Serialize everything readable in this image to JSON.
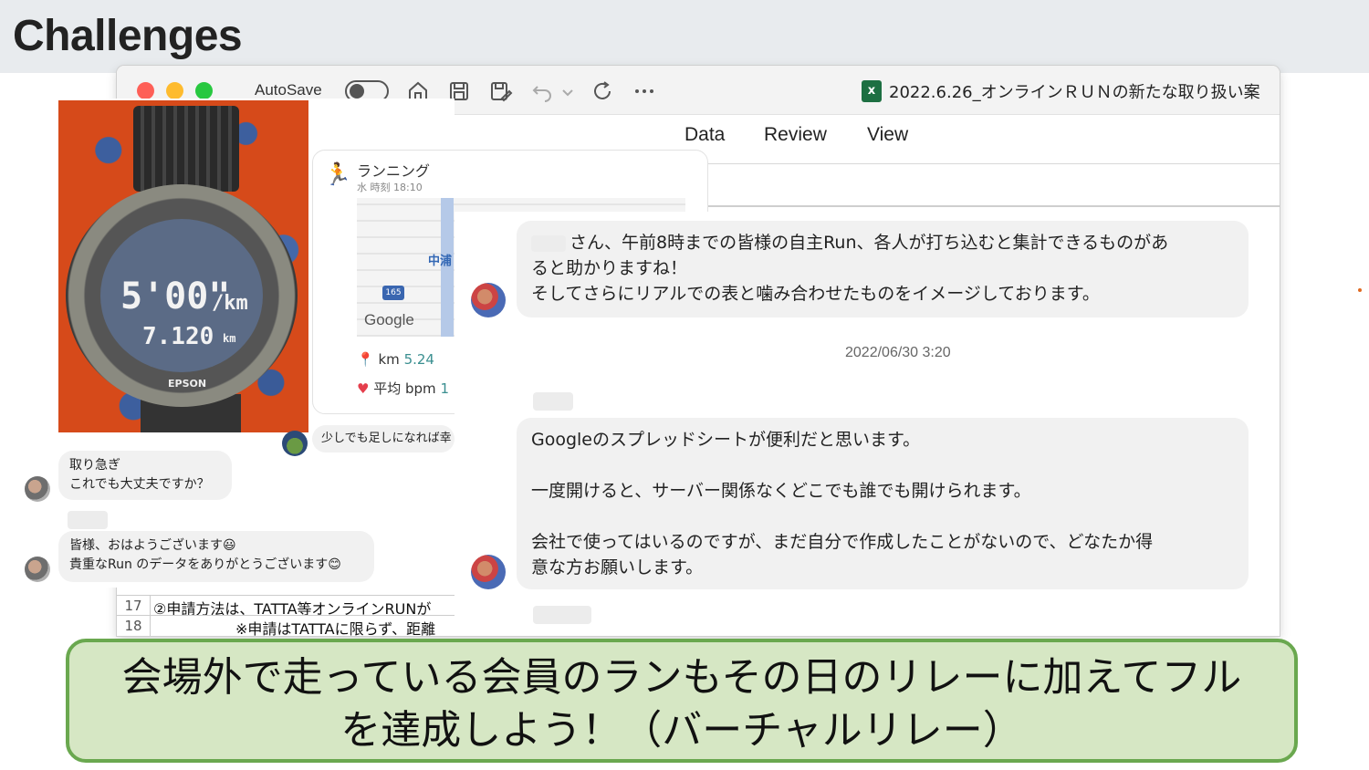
{
  "slide": {
    "title": "Challenges"
  },
  "excel": {
    "autosave_label": "AutoSave",
    "file_name": "2022.6.26_オンラインＲＵＮの新たな取り扱い案",
    "ribbon_tabs": [
      "Data",
      "Review",
      "View"
    ],
    "rows": [
      {
        "num": "17",
        "text": "②申請方法は、TATTA等オンラインRUNが"
      },
      {
        "num": "18",
        "text": "※申請はTATTAに限らず、距離"
      }
    ]
  },
  "left_chat": {
    "watch_photo": {
      "pace": "5'00\"",
      "pace_unit": "/km",
      "distance": "7.120",
      "distance_unit": "km",
      "brand": "EPSON"
    },
    "run_card": {
      "title": "ランニング",
      "time": "水 時刻 18:10",
      "map_label": "中浦",
      "map_shield": "165",
      "map_brand": "Google",
      "distance_label": "km",
      "distance_value": "5.24",
      "heart_label": "平均 bpm",
      "heart_value": "1"
    },
    "msg_small": "少しでも足しになれば幸",
    "msg_1": {
      "line1": "取り急ぎ",
      "line2": "これでも大丈夫ですか？"
    },
    "msg_2": {
      "line1": "皆様、おはようございます😃",
      "line2": "貴重なRun のデータをありがとうございます😊"
    }
  },
  "right_chat": {
    "msg_1": {
      "line1": "さん、午前8時までの皆様の自主Run、各人が打ち込むと集計できるものがあ",
      "line2": "ると助かりますね！",
      "line3": "そしてさらにリアルでの表と噛み合わせたものをイメージしております。"
    },
    "timestamp": "2022/06/30 3:20",
    "msg_2": {
      "line1": "Googleのスプレッドシートが便利だと思います。",
      "line2": "一度開けると、サーバー関係なくどこでも誰でも開けられます。",
      "line3": "会社で使ってはいるのですが、まだ自分で作成したことがないので、どなたか得",
      "line4": "意な方お願いします。"
    }
  },
  "callout": {
    "line1": "会場外で走っている会員のランもその日のリレーに加えてフル",
    "line2": "を達成しよう！（バーチャルリレー）"
  },
  "colors": {
    "callout_bg": "#d6e7c4",
    "callout_border": "#6aa84f",
    "excel_green": "#1d6f42"
  }
}
